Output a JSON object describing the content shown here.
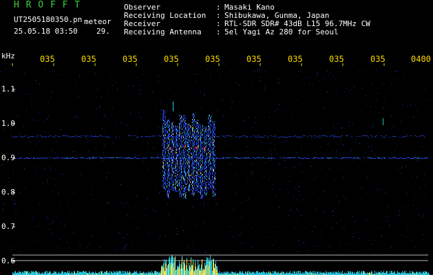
{
  "app": {
    "title": "H R O F F T",
    "filename": "UT2505180350.pn",
    "detection_label": "meteor",
    "datetime": "25.05.18 03:50",
    "count": "29."
  },
  "header": [
    {
      "label": "Observer",
      "value": "Masaki Kano"
    },
    {
      "label": "Receiving Location",
      "value": "Shibukawa, Gunma, Japan"
    },
    {
      "label": "Receiver",
      "value": "RTL-SDR SDR# 43dB L15 96.7MHz CW"
    },
    {
      "label": "Receiving Antenna",
      "value": "5el Yagi Az 280 for Seoul"
    }
  ],
  "axis": {
    "y_unit": "kHz",
    "x_ticks": [
      "035",
      "035",
      "035",
      "035",
      "035",
      "035",
      "035",
      "035",
      "035",
      "0400"
    ],
    "y_ticks": [
      "1.1",
      "1.0",
      "0.9",
      "0.8",
      "0.7",
      "0.6"
    ]
  },
  "colors": {
    "title_green": "#39d13a",
    "text_white": "#ffffff",
    "tick_yellow": "#ffd800",
    "signal_blue": "#2a4bff",
    "signal_cyan": "#2fe8ff",
    "signal_yellow": "#ffe04a",
    "signal_red": "#ff3a2a"
  }
}
